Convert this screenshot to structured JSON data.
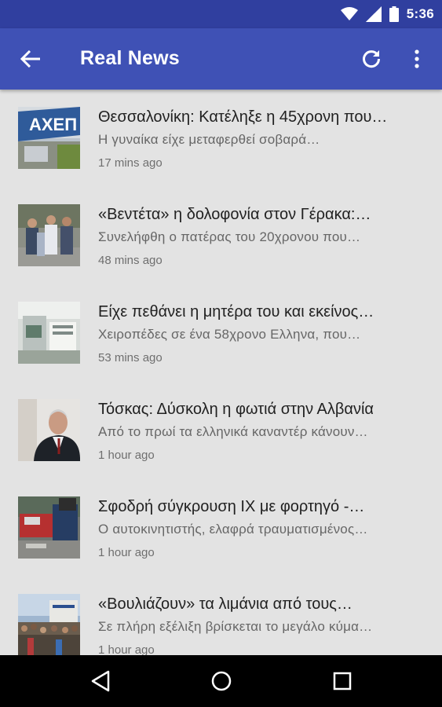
{
  "status_bar": {
    "time": "5:36",
    "icons": [
      "wifi-icon",
      "cellular-signal-icon",
      "battery-icon"
    ]
  },
  "app_bar": {
    "title": "Real News",
    "icons": [
      "back-arrow-icon",
      "refresh-icon",
      "more-vert-icon"
    ]
  },
  "news": [
    {
      "headline": "Θεσσαλονίκη: Κατέληξε η 45χρονη που…",
      "summary": "Η γυναίκα είχε μεταφερθεί σοβαρά…",
      "time": "17 mins ago",
      "thumb": "store-front-image"
    },
    {
      "headline": "«Βεντέτα» η δολοφονία στον Γέρακα:…",
      "summary": "Συνελήφθη ο πατέρας του 20χρονου που…",
      "time": "48 mins ago",
      "thumb": "people-street-image"
    },
    {
      "headline": "Είχε πεθάνει η μητέρα του και εκείνος…",
      "summary": "Χειροπέδες σε ένα 58χρονο Ελληνα, που…",
      "time": "53 mins ago",
      "thumb": "building-interior-image"
    },
    {
      "headline": "Τόσκας: Δύσκολη η φωτιά στην Αλβανία",
      "summary": "Από το πρωί τα ελληνικά καναντέρ κάνουν…",
      "time": "1 hour ago",
      "thumb": "man-portrait-image"
    },
    {
      "headline": "Σφοδρή σύγκρουση ΙΧ με φορτηγό -…",
      "summary": "Ο αυτοκινητιστής, ελαφρά τραυματισμένος…",
      "time": "1 hour ago",
      "thumb": "car-crash-image"
    },
    {
      "headline": "«Βουλιάζουν» τα λιμάνια από τους…",
      "summary": "Σε πλήρη εξέλιξη βρίσκεται το μεγάλο κύμα…",
      "time": "1 hour ago",
      "thumb": "harbor-crowd-image"
    }
  ],
  "nav_bar": {
    "icons": [
      "nav-back-icon",
      "nav-home-icon",
      "nav-recents-icon"
    ]
  }
}
